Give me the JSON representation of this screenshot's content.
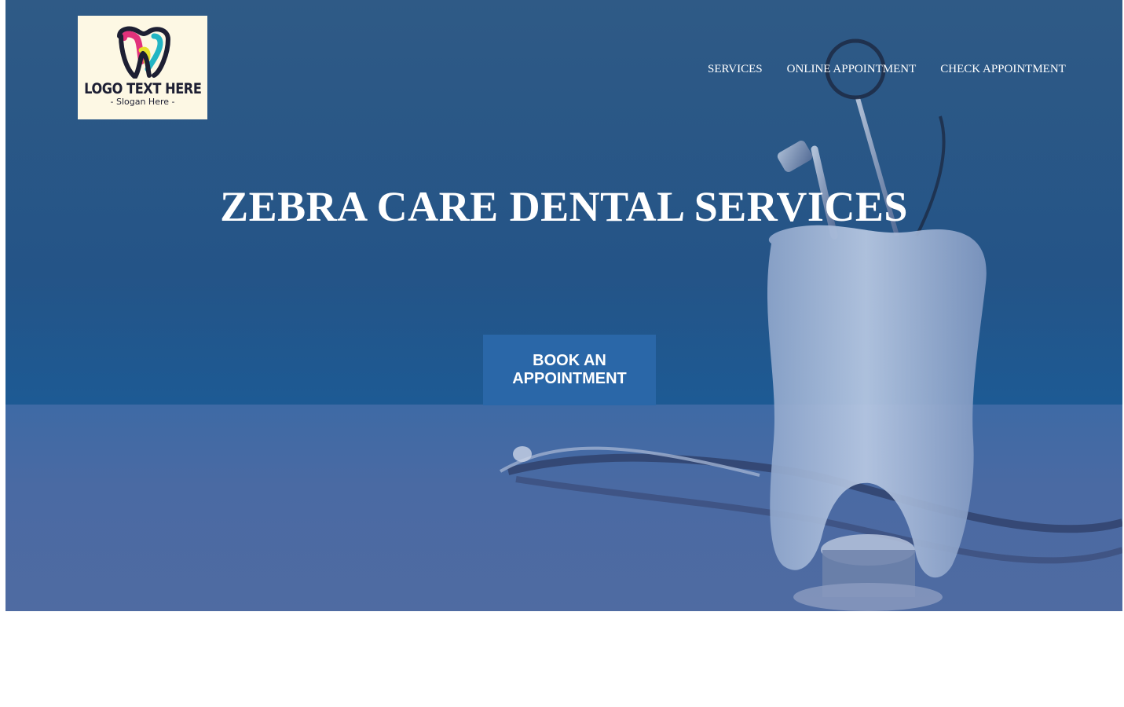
{
  "logo": {
    "text": "LOGO TEXT HERE",
    "slogan": "- Slogan Here -",
    "icon": "tooth-logo-icon"
  },
  "nav": {
    "items": [
      {
        "label": "SERVICES"
      },
      {
        "label": "ONLINE APPOINTMENT"
      },
      {
        "label": "CHECK APPOINTMENT"
      }
    ]
  },
  "hero": {
    "title": "ZEBRA CARE DENTAL SERVICES",
    "cta_label": "BOOK AN APPOINTMENT",
    "background_image": "tooth-model-with-dental-tools-and-stethoscope"
  },
  "colors": {
    "overlay": "#245487",
    "button": "#2a67a8",
    "logo_background": "#fdf8e4",
    "text": "#ffffff"
  }
}
